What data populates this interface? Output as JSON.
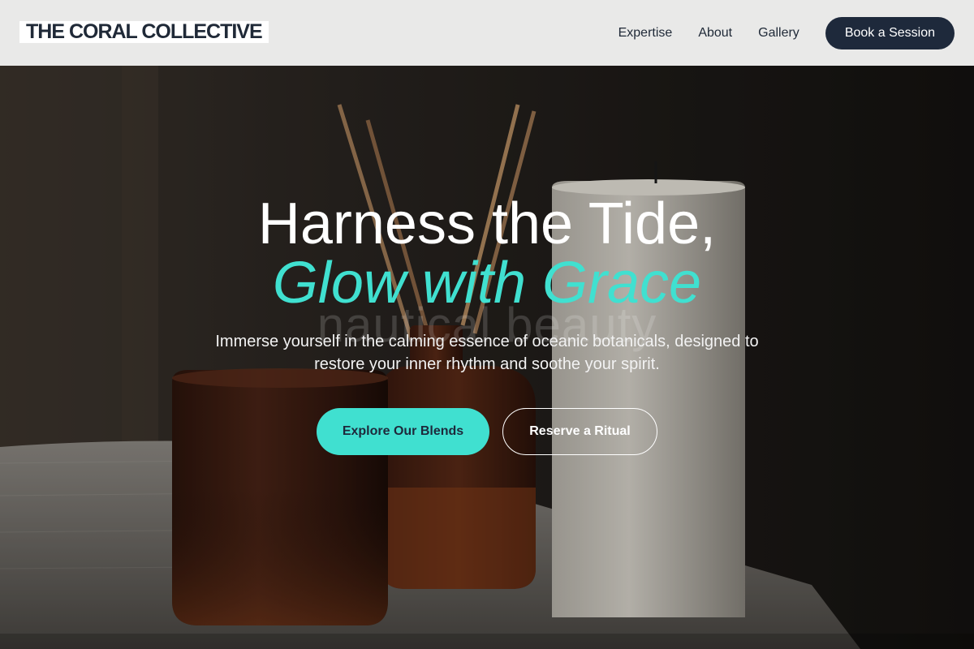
{
  "header": {
    "brand": "THE CORAL COLLECTIVE",
    "nav": [
      {
        "label": "Expertise"
      },
      {
        "label": "About"
      },
      {
        "label": "Gallery"
      }
    ],
    "cta_label": "Book a Session"
  },
  "hero": {
    "headline_line1": "Harness the Tide,",
    "headline_line2": "Glow with Grace",
    "watermark": "nautical beauty",
    "subtitle": "Immerse yourself in the calming essence of oceanic botanicals, designed to restore your inner rhythm and soothe your spirit.",
    "primary_button": "Explore Our Blends",
    "secondary_button": "Reserve a Ritual"
  },
  "colors": {
    "accent": "#40e0d0",
    "navy": "#1e293b",
    "header_bg": "#e9e9e8"
  }
}
